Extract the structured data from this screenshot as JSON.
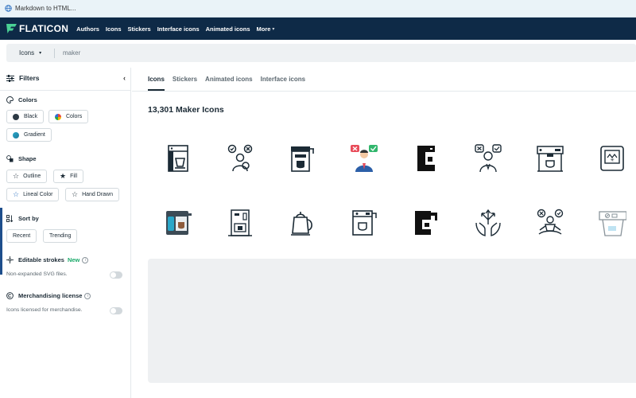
{
  "browser": {
    "tab_title": "Markdown to HTML..."
  },
  "brand": {
    "logo_text": "FLATICON",
    "accent": "#4ad295",
    "nav_bg": "#0e2a47"
  },
  "nav": {
    "links": [
      "Authors",
      "Icons",
      "Stickers",
      "Interface icons",
      "Animated icons",
      "More"
    ]
  },
  "search": {
    "category": "Icons",
    "query": "maker"
  },
  "sidebar": {
    "filters_label": "Filters",
    "colors": {
      "title": "Colors",
      "options": [
        {
          "label": "Black",
          "color": "#2d3a45"
        },
        {
          "label": "Colors"
        },
        {
          "label": "Gradient",
          "color": "#2aa7c9"
        }
      ]
    },
    "shape": {
      "title": "Shape",
      "options": [
        "Outline",
        "Fill",
        "Lineal Color",
        "Hand Drawn"
      ]
    },
    "sort": {
      "title": "Sort by",
      "options": [
        "Recent",
        "Trending"
      ]
    },
    "editable": {
      "title": "Editable strokes",
      "badge": "New",
      "note": "Non-expanded SVG files."
    },
    "merch": {
      "title": "Merchandising license",
      "note": "Icons licensed for merchandise."
    }
  },
  "main": {
    "tabs": [
      "Icons",
      "Stickers",
      "Animated icons",
      "Interface icons"
    ],
    "active_tab": "Icons",
    "results_title": "13,301 Maker Icons",
    "icons_row1": [
      "coffee-machine-icon",
      "decision-maker-icon",
      "espresso-machine-icon",
      "decision-maker-color-icon",
      "coffee-machine-fill-icon",
      "decision-person-icon",
      "espresso-maker-icon",
      "bread-maker-icon"
    ],
    "icons_row2": [
      "coffee-machine-color-icon",
      "vending-coffee-icon",
      "kettle-icon",
      "coffee-maker-outline-icon",
      "coffee-maker-fill-icon",
      "hands-arrows-icon",
      "meditating-decision-icon",
      "ice-maker-icon"
    ]
  }
}
